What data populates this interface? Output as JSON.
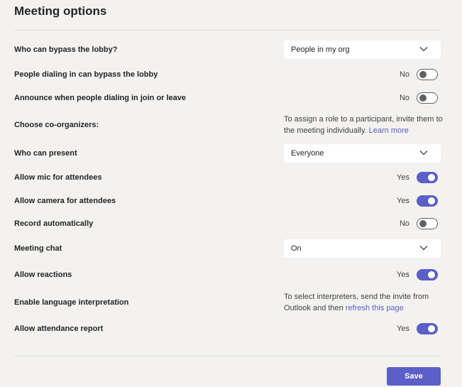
{
  "page": {
    "title": "Meeting options",
    "save_label": "Save"
  },
  "options": {
    "bypass_lobby": {
      "label": "Who can bypass the lobby?",
      "value": "People in my org"
    },
    "dial_in_bypass": {
      "label": "People dialing in can bypass the lobby",
      "state": "No"
    },
    "announce_dial_in": {
      "label": "Announce when people dialing in join or leave",
      "state": "No"
    },
    "co_organizers": {
      "label": "Choose co-organizers:",
      "info_text": "To assign a role to a participant, invite them to the meeting individually.",
      "link": "Learn more"
    },
    "who_can_present": {
      "label": "Who can present",
      "value": "Everyone"
    },
    "allow_mic": {
      "label": "Allow mic for attendees",
      "state": "Yes"
    },
    "allow_camera": {
      "label": "Allow camera for attendees",
      "state": "Yes"
    },
    "record_auto": {
      "label": "Record automatically",
      "state": "No"
    },
    "meeting_chat": {
      "label": "Meeting chat",
      "value": "On"
    },
    "allow_reactions": {
      "label": "Allow reactions",
      "state": "Yes"
    },
    "language_interpretation": {
      "label": "Enable language interpretation",
      "info_text": "To select interpreters, send the invite from Outlook and then",
      "link": "refresh this page"
    },
    "attendance_report": {
      "label": "Allow attendance report",
      "state": "Yes"
    }
  },
  "icons": {
    "dropdown": "chevron-down-icon"
  },
  "colors": {
    "accent": "#5b5fc7",
    "background": "#f3f2f1",
    "text": "#242424"
  }
}
